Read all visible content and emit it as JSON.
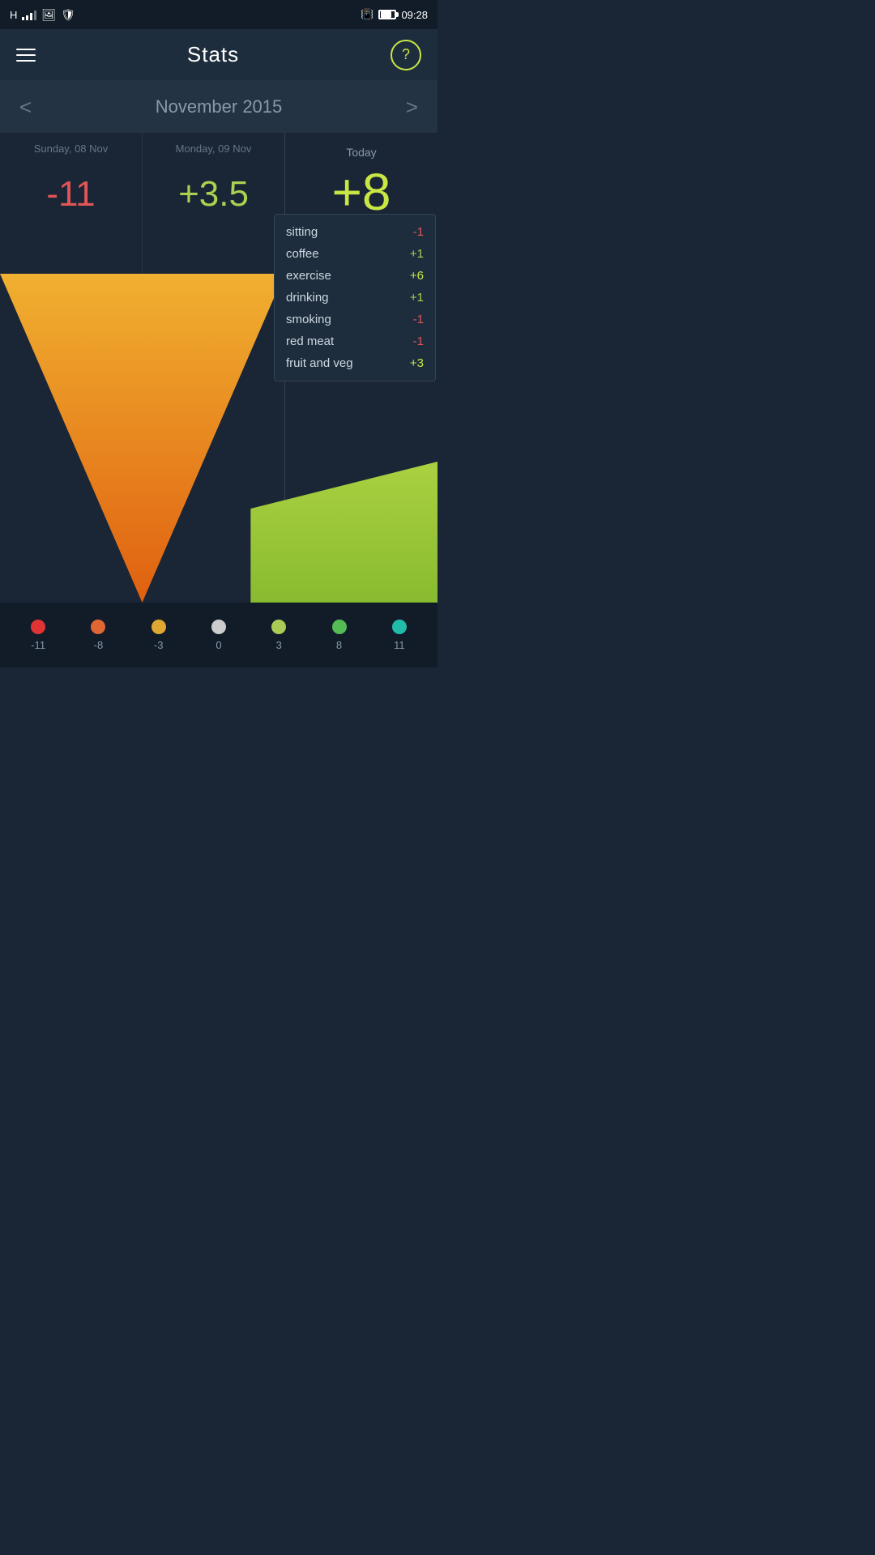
{
  "statusBar": {
    "time": "09:28",
    "carrier": "H"
  },
  "topNav": {
    "title": "Stats",
    "helpIcon": "?"
  },
  "monthNav": {
    "month": "November 2015",
    "prevLabel": "<",
    "nextLabel": ">"
  },
  "days": [
    {
      "name": "Sunday, 08 Nov",
      "score": "-11",
      "scoreType": "negative"
    },
    {
      "name": "Monday, 09 Nov",
      "score": "+3.5",
      "scoreType": "positive"
    }
  ],
  "today": {
    "label": "Today",
    "score": "+8"
  },
  "tooltip": {
    "items": [
      {
        "name": "sitting",
        "value": "-1",
        "type": "negative"
      },
      {
        "name": "coffee",
        "value": "+1",
        "type": "positive"
      },
      {
        "name": "exercise",
        "value": "+6",
        "type": "pos-big"
      },
      {
        "name": "drinking",
        "value": "+1",
        "type": "positive"
      },
      {
        "name": "smoking",
        "value": "-1",
        "type": "negative"
      },
      {
        "name": "red meat",
        "value": "-1",
        "type": "negative"
      },
      {
        "name": "fruit and veg",
        "value": "+3",
        "type": "pos-big"
      }
    ]
  },
  "scoreDots": [
    {
      "value": "-11",
      "color": "#e03333"
    },
    {
      "value": "-8",
      "color": "#e06633"
    },
    {
      "value": "-3",
      "color": "#e0a833"
    },
    {
      "value": "0",
      "color": "#cccccc"
    },
    {
      "value": "3",
      "color": "#aacc55"
    },
    {
      "value": "8",
      "color": "#55bb55"
    },
    {
      "value": "11",
      "color": "#22bbaa"
    }
  ]
}
